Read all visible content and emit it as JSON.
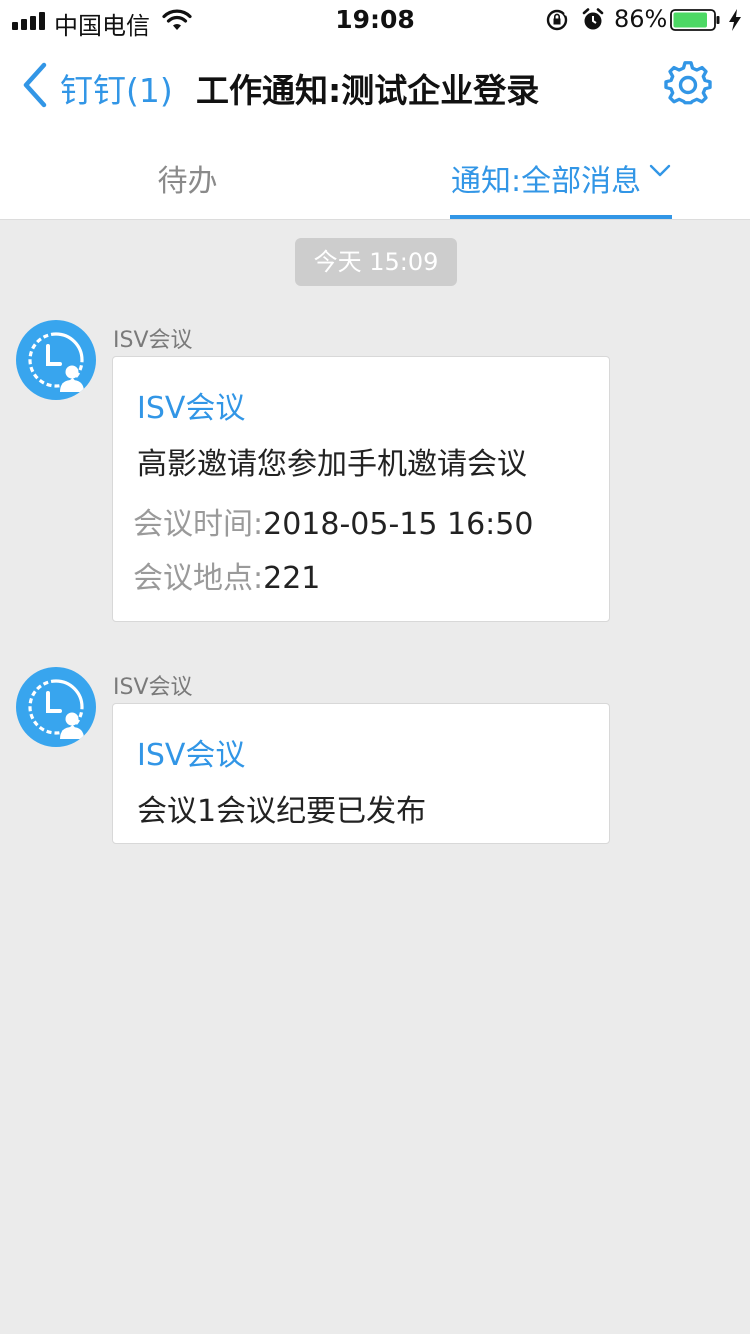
{
  "status_bar": {
    "carrier": "中国电信",
    "time": "19:08",
    "battery_percent": "86%",
    "battery_level": 0.86,
    "icons": [
      "signal-icon",
      "wifi-icon",
      "orientation-lock-icon",
      "alarm-icon",
      "battery-icon",
      "charging-bolt-icon"
    ]
  },
  "nav": {
    "back_label": "钉钉(1)",
    "title": "工作通知:测试企业登录",
    "settings_icon": "gear-icon"
  },
  "tabs": {
    "todo": "待办",
    "notify": "通知:全部消息",
    "active": "notify"
  },
  "timestamp": "今天 15:09",
  "colors": {
    "accent": "#3296e6",
    "avatar_bg": "#38a5ee",
    "background": "#ebebeb"
  },
  "messages": [
    {
      "sender": "ISV会议",
      "card_title": "ISV会议",
      "body": "高影邀请您参加手机邀请会议",
      "fields": [
        {
          "key": "会议时间:",
          "value": "2018-05-15 16:50"
        },
        {
          "key": "会议地点:",
          "value": "221"
        }
      ]
    },
    {
      "sender": "ISV会议",
      "card_title": "ISV会议",
      "body": "会议1会议纪要已发布"
    }
  ]
}
